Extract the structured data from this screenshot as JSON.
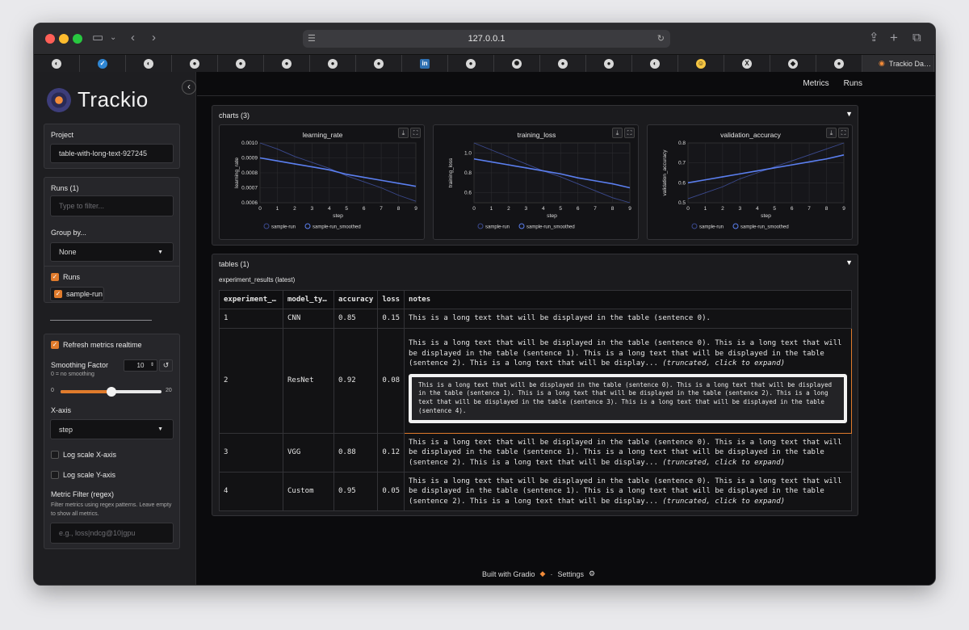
{
  "browser": {
    "url": "127.0.0.1",
    "active_tab_label": "Trackio Da…",
    "tab_icons": [
      "chrome-icon",
      "vscode-icon",
      "chrome-icon",
      "github-icon",
      "github-icon",
      "github-icon",
      "github-icon",
      "github-icon",
      "linkedin-icon",
      "github-icon",
      "openai-icon",
      "github-icon",
      "github-icon",
      "chrome-icon",
      "huggingface-icon",
      "x-icon",
      "cube-icon",
      "github-icon"
    ]
  },
  "sidebar": {
    "logo_text": "Trackio",
    "project_label": "Project",
    "project_value": "table-with-long-text-927245",
    "runs_label": "Runs (1)",
    "runs_filter_placeholder": "Type to filter...",
    "group_by_label": "Group by...",
    "group_by_value": "None",
    "runs_checkbox_label": "Runs",
    "run_item_label": "sample-run",
    "refresh_label": "Refresh metrics realtime",
    "smoothing_label": "Smoothing Factor",
    "smoothing_value": "10",
    "smoothing_hint": "0 = no smoothing",
    "slider_min": "0",
    "slider_max": "20",
    "slider_fraction": 0.5,
    "xaxis_label": "X-axis",
    "xaxis_value": "step",
    "log_x_label": "Log scale X-axis",
    "log_y_label": "Log scale Y-axis",
    "metric_filter_label": "Metric Filter (regex)",
    "metric_filter_help": "Filter metrics using regex patterns. Leave empty to show all metrics.",
    "metric_filter_placeholder": "e.g., loss|ndcg@10|gpu"
  },
  "nav": {
    "metrics": "Metrics",
    "runs": "Runs"
  },
  "charts_section": {
    "title": "charts (3)"
  },
  "chart_data": [
    {
      "type": "line",
      "title": "learning_rate",
      "xlabel": "step",
      "ylabel": "learning_rate",
      "x": [
        0,
        1,
        2,
        3,
        4,
        5,
        6,
        7,
        8,
        9
      ],
      "ylim": [
        0.0006,
        0.001
      ],
      "yticks": [
        "0.0010",
        "0.0009",
        "0.0008",
        "0.0007",
        "0.0006"
      ],
      "series": [
        {
          "name": "sample-run",
          "values": [
            0.001,
            0.00096,
            0.00091,
            0.00087,
            0.00083,
            0.00078,
            0.00074,
            0.0007,
            0.00065,
            0.00061
          ]
        },
        {
          "name": "sample-run_smoothed",
          "values": [
            0.0009,
            0.00088,
            0.00086,
            0.00084,
            0.00082,
            0.00079,
            0.00077,
            0.00075,
            0.00073,
            0.00071
          ]
        }
      ]
    },
    {
      "type": "line",
      "title": "training_loss",
      "xlabel": "step",
      "ylabel": "training_loss",
      "x": [
        0,
        1,
        2,
        3,
        4,
        5,
        6,
        7,
        8,
        9
      ],
      "ylim": [
        0.5,
        1.1
      ],
      "yticks": [
        "1.0",
        "0.8",
        "0.6"
      ],
      "series": [
        {
          "name": "sample-run",
          "values": [
            1.1,
            1.03,
            0.96,
            0.89,
            0.82,
            0.76,
            0.69,
            0.62,
            0.55,
            0.5
          ]
        },
        {
          "name": "sample-run_smoothed",
          "values": [
            0.94,
            0.91,
            0.88,
            0.85,
            0.82,
            0.79,
            0.75,
            0.72,
            0.69,
            0.65
          ]
        }
      ]
    },
    {
      "type": "line",
      "title": "validation_accuracy",
      "xlabel": "step",
      "ylabel": "validation_accuracy",
      "x": [
        0,
        1,
        2,
        3,
        4,
        5,
        6,
        7,
        8,
        9
      ],
      "ylim": [
        0.5,
        0.8
      ],
      "yticks": [
        "0.8",
        "0.7",
        "0.6",
        "0.5"
      ],
      "series": [
        {
          "name": "sample-run",
          "values": [
            0.52,
            0.55,
            0.58,
            0.62,
            0.65,
            0.68,
            0.71,
            0.74,
            0.77,
            0.8
          ]
        },
        {
          "name": "sample-run_smoothed",
          "values": [
            0.6,
            0.615,
            0.63,
            0.645,
            0.66,
            0.675,
            0.69,
            0.705,
            0.72,
            0.74
          ]
        }
      ]
    }
  ],
  "tables_section": {
    "title": "tables (1)",
    "subtitle": "experiment_results (latest)",
    "columns": [
      "experiment_…",
      "model_ty…",
      "accuracy",
      "loss",
      "notes"
    ],
    "rows": [
      {
        "id": "1",
        "model": "CNN",
        "accuracy": "0.85",
        "loss": "0.15",
        "notes": "This is a long text that will be displayed in the table (sentence 0).",
        "truncated": ""
      },
      {
        "id": "2",
        "model": "ResNet",
        "accuracy": "0.92",
        "loss": "0.08",
        "notes": "This is a long text that will be displayed in the table (sentence 0). This is a long text that will be displayed in the table (sentence 1). This is a long text that will be displayed in the table (sentence 2). This is a long text that will be display...",
        "truncated": "(truncated, click to expand)",
        "expanded": "This is a long text that will be displayed in the table (sentence 0). This is a long text that will be displayed in the table (sentence 1). This is a long text that will be displayed in the table (sentence 2). This is a long text that will be displayed in the table (sentence 3). This is a long text that will be displayed in the table (sentence 4)."
      },
      {
        "id": "3",
        "model": "VGG",
        "accuracy": "0.88",
        "loss": "0.12",
        "notes": "This is a long text that will be displayed in the table (sentence 0). This is a long text that will be displayed in the table (sentence 1). This is a long text that will be displayed in the table (sentence 2). This is a long text that will be display...",
        "truncated": "(truncated, click to expand)"
      },
      {
        "id": "4",
        "model": "Custom",
        "accuracy": "0.95",
        "loss": "0.05",
        "notes": "This is a long text that will be displayed in the table (sentence 0). This is a long text that will be displayed in the table (sentence 1). This is a long text that will be displayed in the table (sentence 2). This is a long text that will be display...",
        "truncated": "(truncated, click to expand)"
      }
    ]
  },
  "footer": {
    "built_with": "Built with Gradio",
    "separator": "·",
    "settings": "Settings"
  },
  "colors": {
    "accent": "#e07b2c",
    "run_line": "#3b4a8f",
    "smoothed_line": "#5b7ff0"
  }
}
